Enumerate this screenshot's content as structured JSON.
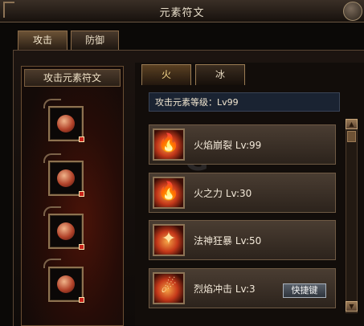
{
  "window": {
    "title": "元素符文"
  },
  "main_tabs": [
    {
      "label": "攻击",
      "active": true
    },
    {
      "label": "防御",
      "active": false
    }
  ],
  "left_panel": {
    "header": "攻击元素符文",
    "slots": 4
  },
  "element_tabs": [
    {
      "label": "火",
      "active": true
    },
    {
      "label": "冰",
      "active": false
    }
  ],
  "attack_level": {
    "label": "攻击元素等级：Lv99"
  },
  "skills": [
    {
      "name": "火焰崩裂",
      "level": "Lv:99",
      "icon": "fire-burst-icon"
    },
    {
      "name": "火之力",
      "level": "Lv:30",
      "icon": "fire-power-icon"
    },
    {
      "name": "法神狂暴",
      "level": "Lv:50",
      "icon": "mage-rage-icon"
    },
    {
      "name": "烈焰冲击",
      "level": "Lv:3",
      "icon": "flame-strike-icon",
      "shortcut": "快捷键"
    }
  ],
  "colors": {
    "accent_gold": "#f7d88c",
    "frame_brown": "#8d7250",
    "level_bar": "#1a2332"
  }
}
